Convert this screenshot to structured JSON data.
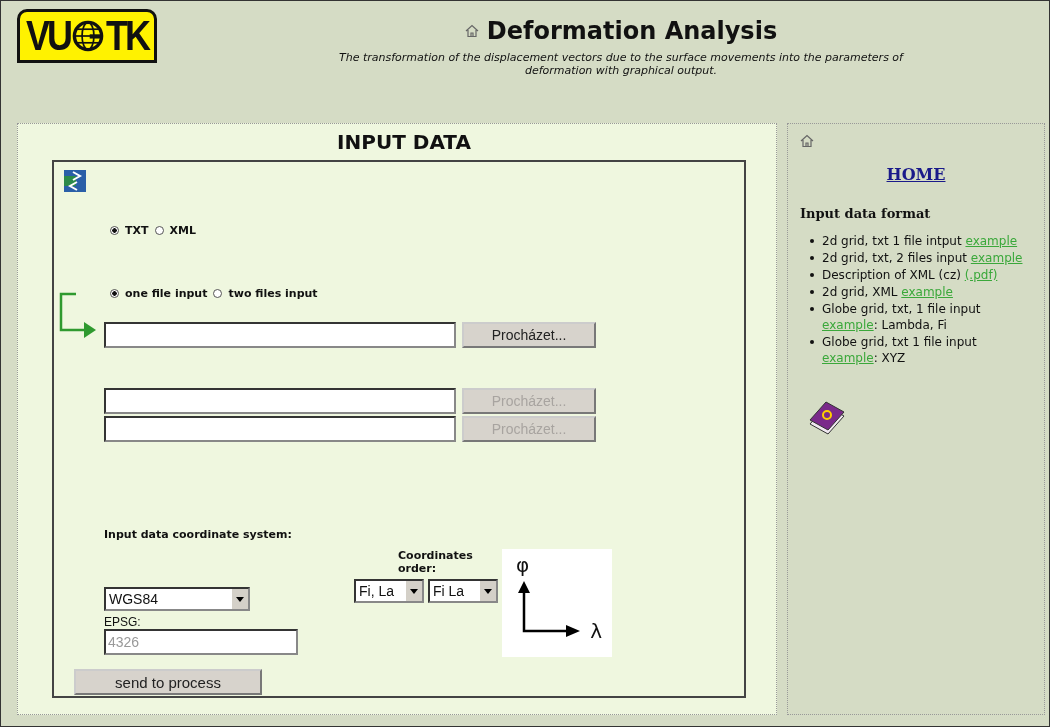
{
  "header": {
    "logo": {
      "left": "VU",
      "right": "TK"
    },
    "title": "Deformation Analysis",
    "subtitle": "The transformation of the displacement vectors due to the surface movements into the parameters of deformation with graphical output."
  },
  "main": {
    "heading": "INPUT DATA",
    "format_options": [
      {
        "label": "TXT",
        "selected": true
      },
      {
        "label": "XML",
        "selected": false
      }
    ],
    "file_mode_options": [
      {
        "label": "one file input",
        "selected": true
      },
      {
        "label": "two files input",
        "selected": false
      }
    ],
    "file_rows": [
      {
        "button": "Procházet...",
        "disabled": false,
        "arrow": true
      },
      {
        "button": "Procházet...",
        "disabled": true,
        "arrow": false
      },
      {
        "button": "Procházet...",
        "disabled": true,
        "arrow": false
      }
    ],
    "coord_label": "Input data coordinate system:",
    "coord_order_label": "Coordinates order:",
    "system_select": "WGS84",
    "order_selects": [
      "Fi, La",
      "Fi La"
    ],
    "epsg_label": "EPSG:",
    "epsg": {
      "value": "4326",
      "disabled": true
    },
    "axis_labels": {
      "y": "φ",
      "x": "λ"
    },
    "submit": "send to process"
  },
  "sidebar": {
    "home": "HOME",
    "heading": "Input data format",
    "items": [
      {
        "text": "2d grid, txt 1 file intput",
        "link": "example"
      },
      {
        "text": "2d grid, txt, 2 files input",
        "link": "example"
      },
      {
        "text": "Description of XML (cz)",
        "link": "(.pdf)"
      },
      {
        "text": "2d grid, XML",
        "link": "example"
      },
      {
        "text": "Globe grid, txt, 1 file input",
        "link": "example",
        "after": ": Lambda, Fi"
      },
      {
        "text": "Globe grid, txt 1 file input",
        "link": "example",
        "after": ": XYZ"
      }
    ]
  }
}
